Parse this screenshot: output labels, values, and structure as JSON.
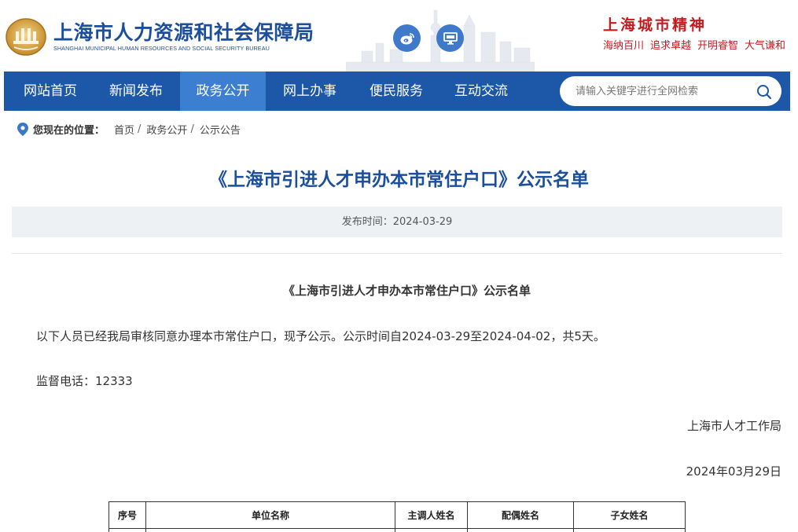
{
  "header": {
    "org_name_cn": "上海市人力资源和社会保障局",
    "org_name_en": "SHANGHAI MUNICIPAL HUMAN RESOURCES AND SOCIAL SECURITY BUREAU",
    "weibo_icon": "weibo-icon",
    "desktop_icon": "desktop-icon",
    "spirit_title": "上海城市精神",
    "spirit_items": [
      "海纳百川",
      "追求卓越",
      "开明睿智",
      "大气谦和"
    ],
    "colors": {
      "brand_blue": "#1b4f9c",
      "spirit_red": "#c8191f"
    }
  },
  "nav": {
    "items": [
      {
        "label": "网站首页",
        "active": false
      },
      {
        "label": "新闻发布",
        "active": false
      },
      {
        "label": "政务公开",
        "active": true
      },
      {
        "label": "网上办事",
        "active": false
      },
      {
        "label": "便民服务",
        "active": false
      },
      {
        "label": "互动交流",
        "active": false
      }
    ],
    "search_placeholder": "请输入关键字进行全网检索",
    "colors": {
      "bar": "#1c57a8",
      "active": "#3c7fd0"
    }
  },
  "breadcrumb": {
    "label": "您现在的位置：",
    "items": [
      "首页",
      "政务公开",
      "公示公告"
    ]
  },
  "article": {
    "title": "《上海市引进人才申办本市常住户口》公示名单",
    "publish_time": "发布时间：2024-03-29",
    "body_title": "《上海市引进人才申办本市常住户口》公示名单",
    "paragraph": "以下人员已经我局审核同意办理本市常住户口，现予公示。公示时间自2024-03-29至2024-04-02，共5天。",
    "phone": "监督电话：12333",
    "issuer": "上海市人才工作局",
    "date": "2024年03月29日"
  },
  "table": {
    "headers": [
      "序号",
      "单位名称",
      "主调人姓名",
      "配偶姓名",
      "子女姓名"
    ]
  }
}
